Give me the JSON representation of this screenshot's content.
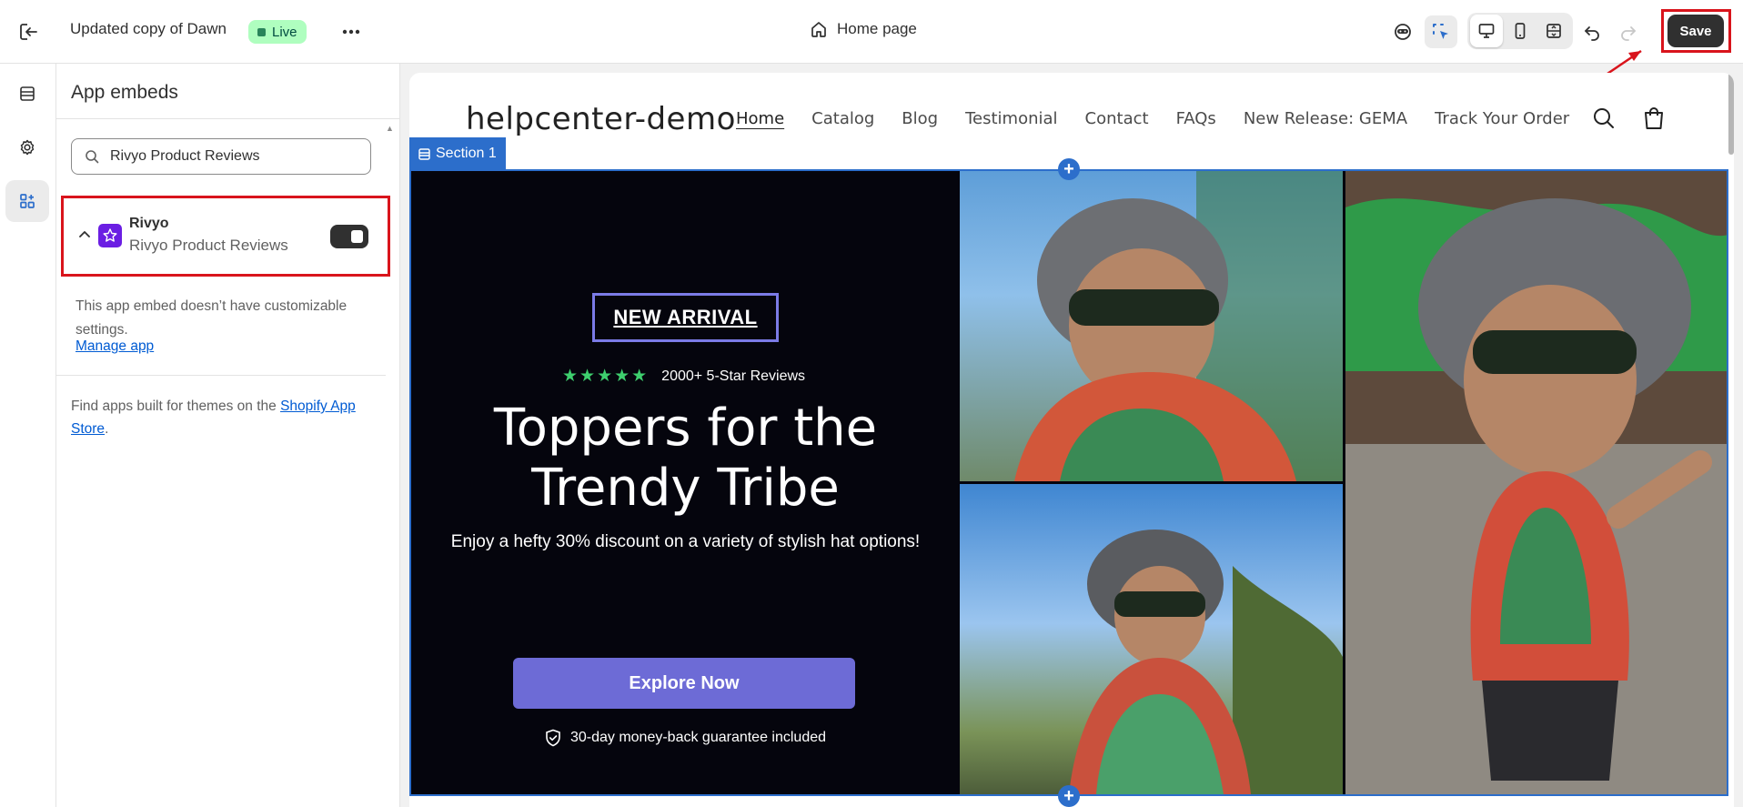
{
  "topbar": {
    "theme_name": "Updated copy of Dawn",
    "status": "Live",
    "page": "Home page",
    "save_label": "Save"
  },
  "panel": {
    "title": "App embeds",
    "search_value": "Rivyo Product Reviews",
    "app": {
      "name": "Rivyo",
      "subtitle": "Rivyo Product Reviews",
      "enabled": true
    },
    "note": "This app embed doesn’t have customizable settings.",
    "manage_link": "Manage app",
    "find_prefix": "Find apps built for themes on the ",
    "find_link": "Shopify App Store",
    "find_suffix": "."
  },
  "store": {
    "logo": "helpcenter-demo",
    "nav": [
      "Home",
      "Catalog",
      "Blog",
      "Testimonial",
      "Contact",
      "FAQs",
      "New Release: GEMA",
      "Track Your Order"
    ],
    "section_tag": "Section 1",
    "badge": "NEW ARRIVAL",
    "reviews": "2000+ 5-Star Reviews",
    "stars": "★★★★★",
    "title_line1": "Toppers for the",
    "title_line2": "Trendy Tribe",
    "subtitle": "Enjoy a hefty 30% discount on a variety of stylish hat options!",
    "cta": "Explore Now",
    "guarantee": "30-day money-back guarantee included"
  },
  "colors": {
    "accent": "#2c6ecb",
    "save": "#303030",
    "highlight": "#d9141c",
    "cta": "#6d6bd6",
    "stars": "#3ecf6e"
  }
}
